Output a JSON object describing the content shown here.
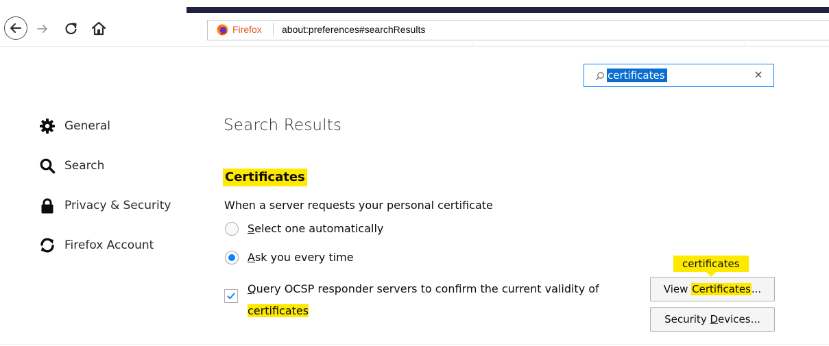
{
  "browser": {
    "identity_label": "Firefox",
    "url": "about:preferences#searchResults"
  },
  "find": {
    "value": "certificates",
    "clear_glyph": "×"
  },
  "sidebar": {
    "items": [
      {
        "label": "General",
        "icon": "gear-icon"
      },
      {
        "label": "Search",
        "icon": "search-icon"
      },
      {
        "label": "Privacy & Security",
        "icon": "lock-icon"
      },
      {
        "label": "Firefox Account",
        "icon": "sync-icon"
      }
    ]
  },
  "main": {
    "results_heading": "Search Results",
    "section_title": "Certificates",
    "request_prompt": "When a server requests your personal certificate",
    "radio_options": [
      {
        "access_key": "S",
        "rest": "elect one automatically",
        "checked": false
      },
      {
        "access_key": "A",
        "rest": "sk you every time",
        "checked": true
      }
    ],
    "ocsp": {
      "access_key": "Q",
      "text": "uery OCSP responder servers to confirm the current validity of",
      "highlight": "certificates",
      "checked": true
    },
    "tooltip": "certificates",
    "view_button": {
      "prefix": "View ",
      "highlight": "Certificates",
      "suffix": "..."
    },
    "devices_button": {
      "prefix": "Security ",
      "access_key": "D",
      "suffix": "evices..."
    }
  },
  "colors": {
    "highlight": "#ffe900",
    "accent": "#0a84ff",
    "selection": "#0a6ed1"
  }
}
